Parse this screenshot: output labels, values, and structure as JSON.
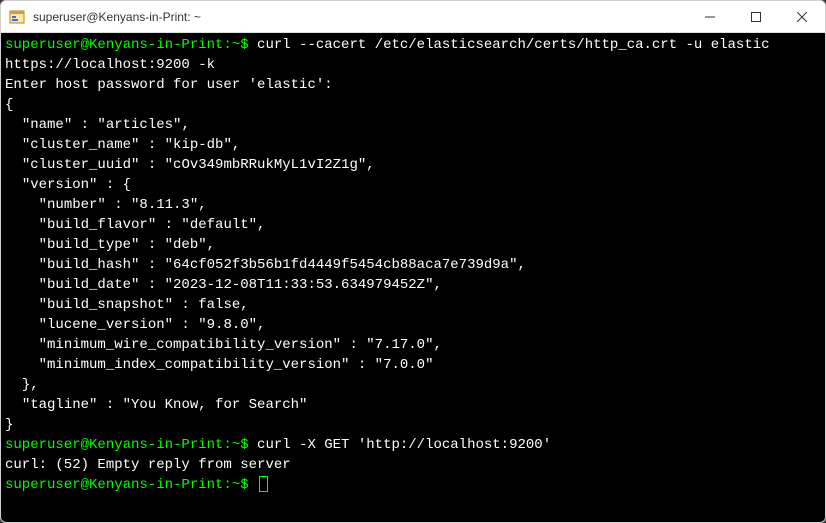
{
  "window": {
    "title": "superuser@Kenyans-in-Print: ~"
  },
  "terminal": {
    "prompt1": "superuser@Kenyans-in-Print:~$",
    "cmd1": " curl --cacert /etc/elasticsearch/certs/http_ca.crt -u elastic https://localhost:9200 -k",
    "line_passprompt": "Enter host password for user 'elastic':",
    "json_open": "{",
    "json_name": "  \"name\" : \"articles\",",
    "json_cluster_name": "  \"cluster_name\" : \"kip-db\",",
    "json_cluster_uuid": "  \"cluster_uuid\" : \"cOv349mbRRukMyL1vI2Z1g\",",
    "json_version_open": "  \"version\" : {",
    "json_number": "    \"number\" : \"8.11.3\",",
    "json_build_flavor": "    \"build_flavor\" : \"default\",",
    "json_build_type": "    \"build_type\" : \"deb\",",
    "json_build_hash": "    \"build_hash\" : \"64cf052f3b56b1fd4449f5454cb88aca7e739d9a\",",
    "json_build_date": "    \"build_date\" : \"2023-12-08T11:33:53.634979452Z\",",
    "json_build_snapshot": "    \"build_snapshot\" : false,",
    "json_lucene_version": "    \"lucene_version\" : \"9.8.0\",",
    "json_min_wire": "    \"minimum_wire_compatibility_version\" : \"7.17.0\",",
    "json_min_index": "    \"minimum_index_compatibility_version\" : \"7.0.0\"",
    "json_version_close": "  },",
    "json_tagline": "  \"tagline\" : \"You Know, for Search\"",
    "json_close": "}",
    "prompt2": "superuser@Kenyans-in-Print:~$",
    "cmd2": " curl -X GET 'http://localhost:9200'",
    "line_error": "curl: (52) Empty reply from server",
    "prompt3": "superuser@Kenyans-in-Print:~$"
  }
}
